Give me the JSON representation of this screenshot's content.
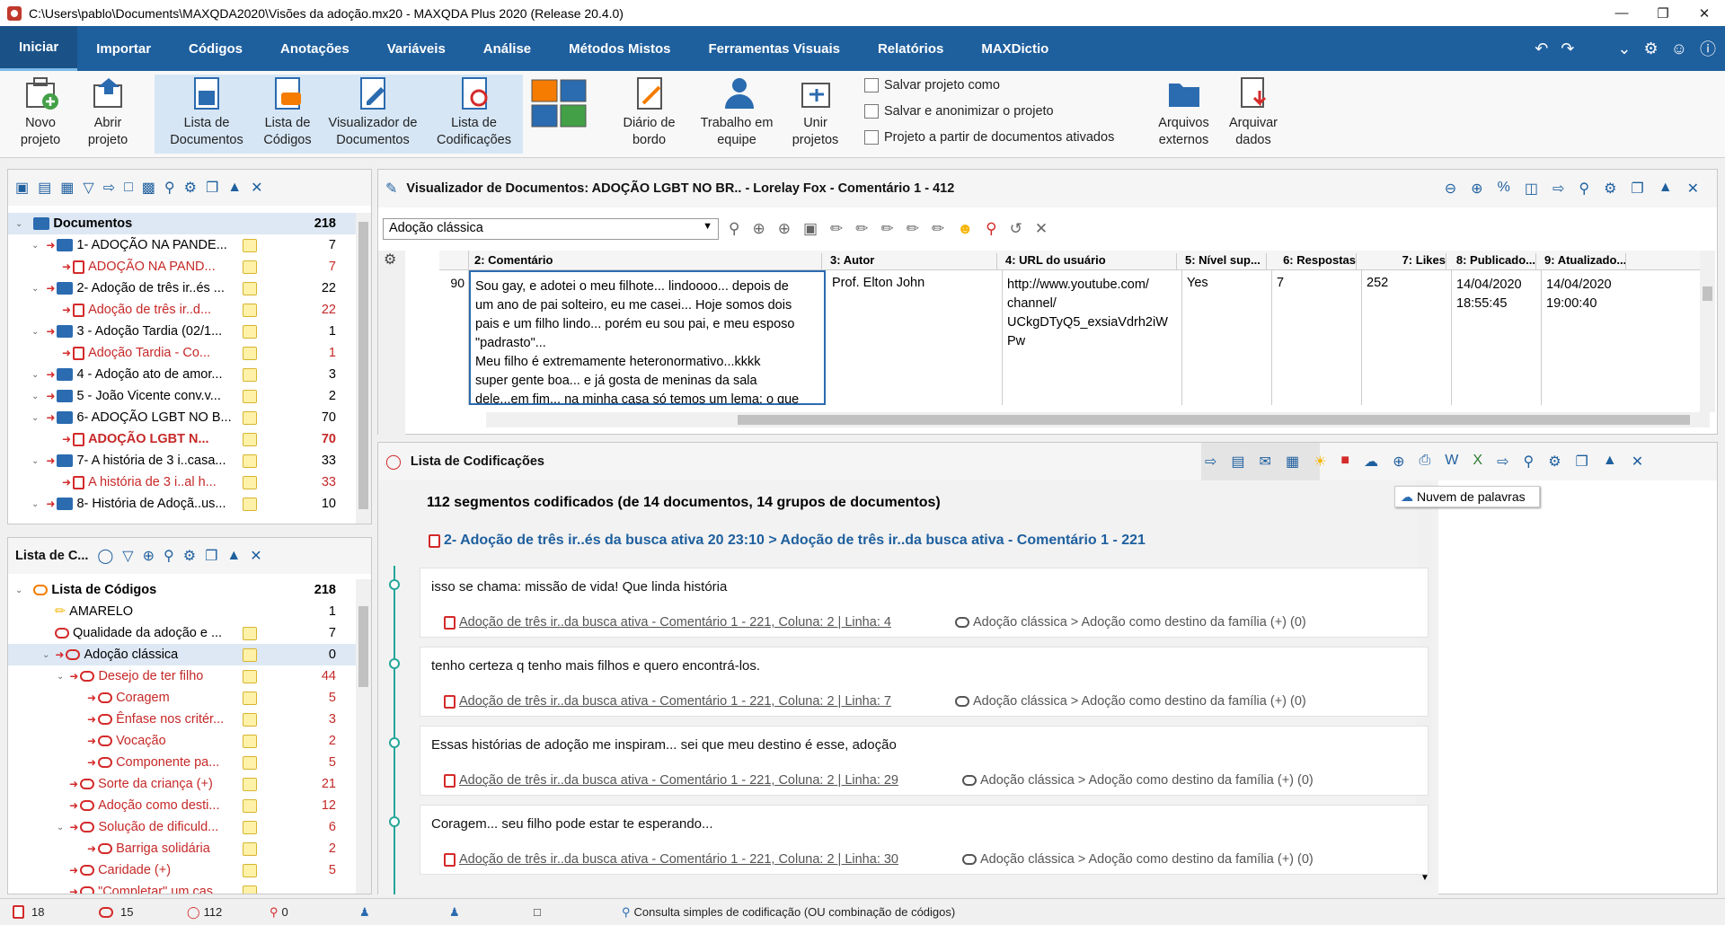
{
  "window": {
    "title": "C:\\Users\\pablo\\Documents\\MAXQDA2020\\Visões da adoção.mx20 - MAXQDA Plus 2020 (Release 20.4.0)"
  },
  "menu": {
    "tabs": [
      "Iniciar",
      "Importar",
      "Códigos",
      "Anotações",
      "Variáveis",
      "Análise",
      "Métodos Mistos",
      "Ferramentas Visuais",
      "Relatórios",
      "MAXDictio"
    ]
  },
  "ribbon": {
    "novo": [
      "Novo",
      "projeto"
    ],
    "abrir": [
      "Abrir",
      "projeto"
    ],
    "listadoc": [
      "Lista de",
      "Documentos"
    ],
    "listacod": [
      "Lista de",
      "Códigos"
    ],
    "visdoc": [
      "Visualizador de",
      "Documentos"
    ],
    "listacodif": [
      "Lista de",
      "Codificações"
    ],
    "diario": [
      "Diário de",
      "bordo"
    ],
    "trabalho": [
      "Trabalho em",
      "equipe"
    ],
    "unir": [
      "Unir",
      "projetos"
    ],
    "salvar": "Salvar projeto como",
    "anonimizar": "Salvar e anonimizar o projeto",
    "projeto_docs": "Projeto a partir de documentos ativados",
    "arquivos": [
      "Arquivos",
      "externos"
    ],
    "arquivar": [
      "Arquivar",
      "dados"
    ]
  },
  "doclist": {
    "root": {
      "label": "Documentos",
      "count": "218"
    },
    "items": [
      {
        "label": "1- ADOÇÃO NA PANDE...",
        "count": "7",
        "type": "group"
      },
      {
        "label": "ADOÇÃO NA PAND...",
        "count": "7",
        "type": "doc"
      },
      {
        "label": "2- Adoção de três ir..és ...",
        "count": "22",
        "type": "group"
      },
      {
        "label": "Adoção de três ir..d...",
        "count": "22",
        "type": "doc"
      },
      {
        "label": "3 - Adoção Tardia (02/1...",
        "count": "1",
        "type": "group"
      },
      {
        "label": "Adoção Tardia -  Co...",
        "count": "1",
        "type": "doc"
      },
      {
        "label": "4 - Adoção ato de amor...",
        "count": "3",
        "type": "group"
      },
      {
        "label": "5 - João Vicente conv.v...",
        "count": "2",
        "type": "group"
      },
      {
        "label": "6- ADOÇÃO LGBT NO B...",
        "count": "70",
        "type": "group"
      },
      {
        "label": "ADOÇÃO LGBT N...",
        "count": "70",
        "type": "active"
      },
      {
        "label": "7- A história de 3 i..casa...",
        "count": "33",
        "type": "group"
      },
      {
        "label": "A história de 3 i..al h...",
        "count": "33",
        "type": "doc"
      },
      {
        "label": "8- História de Adoçã..us...",
        "count": "10",
        "type": "group"
      }
    ]
  },
  "codelist": {
    "title": "Lista de C...",
    "root": {
      "label": "Lista de Códigos",
      "count": "218"
    },
    "items": [
      {
        "label": "AMARELO",
        "count": "1"
      },
      {
        "label": "Qualidade da adoção e ...",
        "count": "7"
      },
      {
        "label": "Adoção clássica",
        "count": "0"
      },
      {
        "label": "Desejo de ter filho",
        "count": "44"
      },
      {
        "label": "Coragem",
        "count": "5"
      },
      {
        "label": "Ênfase nos critér...",
        "count": "3"
      },
      {
        "label": "Vocação",
        "count": "2"
      },
      {
        "label": "Componente pa...",
        "count": "5"
      },
      {
        "label": "Sorte da criança (+)",
        "count": "21"
      },
      {
        "label": "Adoção como desti...",
        "count": "12"
      },
      {
        "label": "Solução de dificuld...",
        "count": "6"
      },
      {
        "label": "Barriga solidária",
        "count": "2"
      },
      {
        "label": "Caridade (+)",
        "count": "5"
      },
      {
        "label": "\"Completar\" um cas...",
        "count": ""
      }
    ]
  },
  "viewer": {
    "title": "Visualizador de Documentos: ADOÇÃO LGBT NO BR.. - Lorelay Fox -  Comentário 1 - 412",
    "code_select": "Adoção clássica",
    "columns": [
      "2: Comentário",
      "3: Autor",
      "4: URL do usuário",
      "5: Nível sup...",
      "6: Respostas",
      "7: Likes",
      "8: Publicado...",
      "9: Atualizado..."
    ],
    "row": {
      "num": "90",
      "comment": [
        "Sou gay, e adotei o meu filhote... lindoooo... depois de",
        "um ano de pai solteiro, eu me casei... Hoje somos dois",
        "pais e um filho lindo... porém eu sou pai, e meu esposo",
        "\"padrasto\"...",
        "Meu filho é extremamente heteronormativo...kkkk",
        "super gente boa... e já gosta de meninas da sala",
        "dele...em fim... na minha casa só temos um lema: o que"
      ],
      "author": "Prof. Elton John",
      "url": [
        "http://www.youtube.com/",
        "channel/",
        "UCkgDTyQ5_exsiaVdrh2iW",
        "Pw"
      ],
      "nivel": "Yes",
      "respostas": "7",
      "likes": "252",
      "publicado": [
        "14/04/2020",
        "18:55:45"
      ],
      "atualizado": [
        "14/04/2020",
        "19:00:40"
      ]
    }
  },
  "codings": {
    "title": "Lista de Codificações",
    "tooltip": "Nuvem de palavras",
    "summary": "112 segmentos codificados (de 14 documentos, 14 grupos de documentos)",
    "doc_header": "2- Adoção de três ir..és da busca ativa 20 23:10 > Adoção de três ir..da busca ativa -  Comentário 1 - 221",
    "segments": [
      {
        "text": "isso se chama: missão de vida! Que linda história",
        "ref": "Adoção de três ir..da busca ativa -  Comentário 1 - 221, Coluna: 2 | Linha: 4",
        "code": "Adoção clássica > Adoção como destino da família (+) (0)"
      },
      {
        "text": "tenho certeza q tenho mais filhos e quero encontrá-los.",
        "ref": "Adoção de três ir..da busca ativa -  Comentário 1 - 221, Coluna: 2 | Linha: 7",
        "code": "Adoção clássica > Adoção como destino da família (+) (0)"
      },
      {
        "text": "Essas histórias de adoção me inspiram... sei que meu destino é esse, adoção",
        "ref": "Adoção de três ir..da busca ativa -  Comentário 1 - 221, Coluna: 2 | Linha: 29",
        "code": "Adoção clássica > Adoção como destino da família (+) (0)"
      },
      {
        "text": "Coragem... seu filho pode estar te esperando...",
        "ref": "Adoção de três ir..da busca ativa -  Comentário 1 - 221, Coluna: 2 | Linha: 30",
        "code": "Adoção clássica > Adoção como destino da família (+) (0)"
      }
    ]
  },
  "status": {
    "docs": "18",
    "codes": "15",
    "segments": "112",
    "memos": "0",
    "query": "Consulta simples de codificação (OU combinação de códigos)"
  }
}
